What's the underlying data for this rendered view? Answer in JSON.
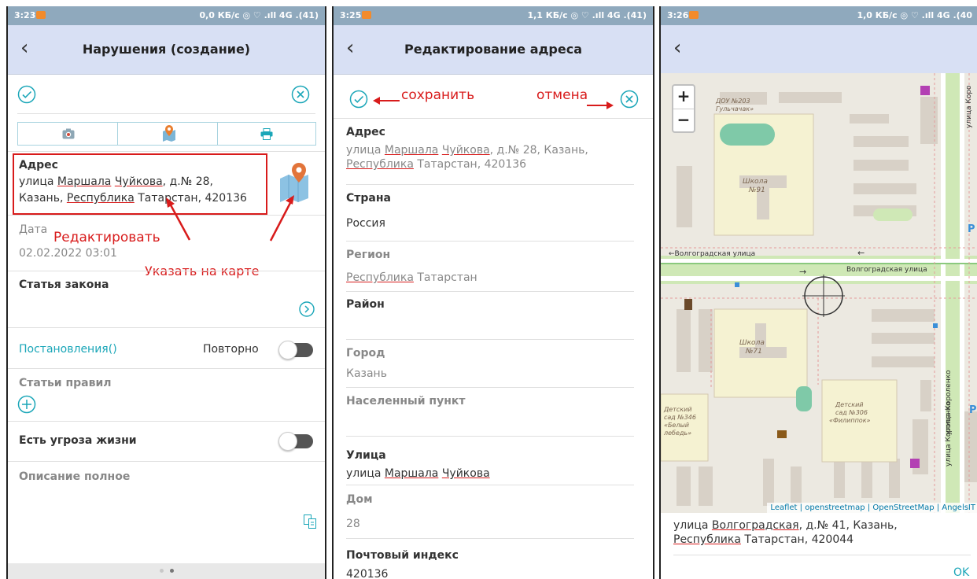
{
  "status_bars": [
    {
      "time": "3:23",
      "right": "0,0 КБ/с ◎ ♡ .ıll 4G .(41)"
    },
    {
      "time": "3:25",
      "right": "1,1 КБ/с ◎ ♡ .ıll 4G .(41)"
    },
    {
      "time": "3:26",
      "right": "1,0 КБ/с ◎ ♡ .ıll 4G .(40"
    }
  ],
  "screen1": {
    "title": "Нарушения (создание)",
    "address_label": "Адрес",
    "address_line1_pre": "улица ",
    "address_line1_w1": "Маршала",
    "address_line1_sp": " ",
    "address_line1_w2": "Чуйкова",
    "address_line1_post": ", д.№ 28,",
    "address_line2_pre": "Казань, ",
    "address_line2_w1": "Республика",
    "address_line2_post": " Татарстан, 420136",
    "annotation_edit": "Редактировать",
    "annotation_map": "Указать на карте",
    "date_label": "Дата",
    "date_value": "02.02.2022 03:01",
    "law_label": "Статья закона",
    "resolutions_link": "Постановления()",
    "repeat_label": "Повторно",
    "rules_label": "Статьи правил",
    "threat_label": "Есть угроза жизни",
    "description_label": "Описание полное",
    "accent": "#1aa6b8",
    "annotation_color": "#d81b1b"
  },
  "screen2": {
    "title": "Редактирование адреса",
    "annotation_save": "сохранить",
    "annotation_cancel": "отмена",
    "address_label": "Адрес",
    "address_line1_pre": "улица ",
    "address_line1_w1": "Маршала",
    "address_line1_sp": " ",
    "address_line1_w2": "Чуйкова",
    "address_line1_post": ", д.№ 28, Казань,",
    "address_line2_w1": "Республика",
    "address_line2_post": " Татарстан, 420136",
    "country_label": "Страна",
    "country_value": "Россия",
    "region_label": "Регион",
    "region_w1": "Республика",
    "region_post": " Татарстан",
    "district_label": "Район",
    "city_label": "Город",
    "city_value": "Казань",
    "locality_label": "Населенный пункт",
    "street_label": "Улица",
    "street_pre": "улица ",
    "street_w1": "Маршала",
    "street_sp": " ",
    "street_w2": "Чуйкова",
    "house_label": "Дом",
    "house_value": "28",
    "postal_label": "Почтовый индекс",
    "postal_value": "420136"
  },
  "screen3": {
    "zoom_in": "+",
    "zoom_out": "−",
    "map_labels": {
      "dou": "ДОУ №203",
      "dou2": "Гульчачак»",
      "school91a": "Школа",
      "school91b": "№91",
      "street_left": "←Волгоградская улица",
      "street_right": "Волгоградская улица",
      "arrow_a": "←",
      "arrow_b": "→",
      "school71a": "Школа",
      "school71b": "№71",
      "kg346a": "Детский",
      "kg346b": "сад №346",
      "kg346c": "«Белый",
      "kg346d": "лебедь»",
      "kg306a": "Детский",
      "kg306b": "сад №306",
      "kg306c": "«Филиппок»",
      "korolenko_top": "улица Коро",
      "korolenko_mid": "улица Короленко",
      "korolenko_bot": "улица Короленко",
      "p1": "P",
      "p2": "P"
    },
    "attribution": "Leaflet | openstreetmap | OpenStreetMap | AngelsIT",
    "address_line1_pre": "улица ",
    "address_line1_w1": "Волгоградская",
    "address_line1_post": ", д.№ 41, Казань,",
    "address_line2_w1": "Республика",
    "address_line2_post": " Татарстан, 420044",
    "ok_label": "OK"
  }
}
